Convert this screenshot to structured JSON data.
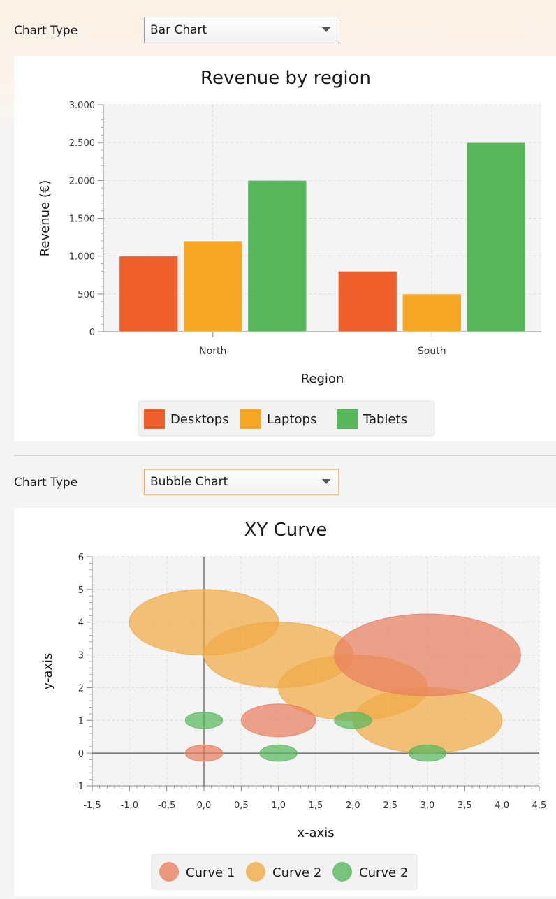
{
  "panels": [
    {
      "control": {
        "label": "Chart Type",
        "selected": "Bar Chart"
      },
      "chart_data": {
        "type": "bar",
        "title": "Revenue by region",
        "xlabel": "Region",
        "ylabel": "Revenue (€)",
        "categories": [
          "North",
          "South"
        ],
        "ylim": [
          0,
          3000
        ],
        "yticks": [
          0,
          500,
          1000,
          1500,
          2000,
          2500,
          3000
        ],
        "ytick_labels": [
          "0",
          "500",
          "1.000",
          "1.500",
          "2.000",
          "2.500",
          "3.000"
        ],
        "series": [
          {
            "name": "Desktops",
            "values": [
              1000,
              800
            ],
            "color": "#ee5f2b"
          },
          {
            "name": "Laptops",
            "values": [
              1200,
              500
            ],
            "color": "#f5a623"
          },
          {
            "name": "Tablets",
            "values": [
              2000,
              2500
            ],
            "color": "#55b65a"
          }
        ],
        "grid": true,
        "legend": "bottom-center"
      }
    },
    {
      "control": {
        "label": "Chart Type",
        "selected": "Bubble Chart"
      },
      "chart_data": {
        "type": "scatter",
        "subtype": "bubble",
        "title": "XY Curve",
        "xlabel": "x-axis",
        "ylabel": "y-axis",
        "xlim": [
          -1.5,
          4.5
        ],
        "ylim": [
          -1,
          6
        ],
        "xticks": [
          -1.5,
          -1.0,
          -0.5,
          0.0,
          0.5,
          1.0,
          1.5,
          2.0,
          2.5,
          3.0,
          3.5,
          4.0,
          4.5
        ],
        "xtick_labels": [
          "-1,5",
          "-1,0",
          "-0,5",
          "0,0",
          "0,5",
          "1,0",
          "1,5",
          "2,0",
          "2,5",
          "3,0",
          "3,5",
          "4,0",
          "4,5"
        ],
        "yticks": [
          -1,
          0,
          1,
          2,
          3,
          4,
          5,
          6
        ],
        "ytick_labels": [
          "-1",
          "0",
          "1",
          "2",
          "3",
          "4",
          "5",
          "6"
        ],
        "series": [
          {
            "name": "Curve 1",
            "color": "#e9805f",
            "points": [
              {
                "x": 0,
                "y": 0,
                "r": 0.25
              },
              {
                "x": 1,
                "y": 1,
                "r": 0.5
              },
              {
                "x": 3,
                "y": 3,
                "r": 1.25
              }
            ]
          },
          {
            "name": "Curve 2",
            "color": "#f0aa45",
            "points": [
              {
                "x": 0,
                "y": 4,
                "r": 1.0
              },
              {
                "x": 1,
                "y": 3,
                "r": 1.0
              },
              {
                "x": 2,
                "y": 2,
                "r": 1.0
              },
              {
                "x": 3,
                "y": 1,
                "r": 1.0
              }
            ]
          },
          {
            "name": "Curve 2",
            "color": "#5ab85f",
            "points": [
              {
                "x": 0,
                "y": 1,
                "r": 0.25
              },
              {
                "x": 1,
                "y": 0,
                "r": 0.25
              },
              {
                "x": 2,
                "y": 1,
                "r": 0.25
              },
              {
                "x": 3,
                "y": 0,
                "r": 0.25
              }
            ]
          }
        ],
        "grid": true,
        "legend": "bottom-center"
      }
    }
  ]
}
